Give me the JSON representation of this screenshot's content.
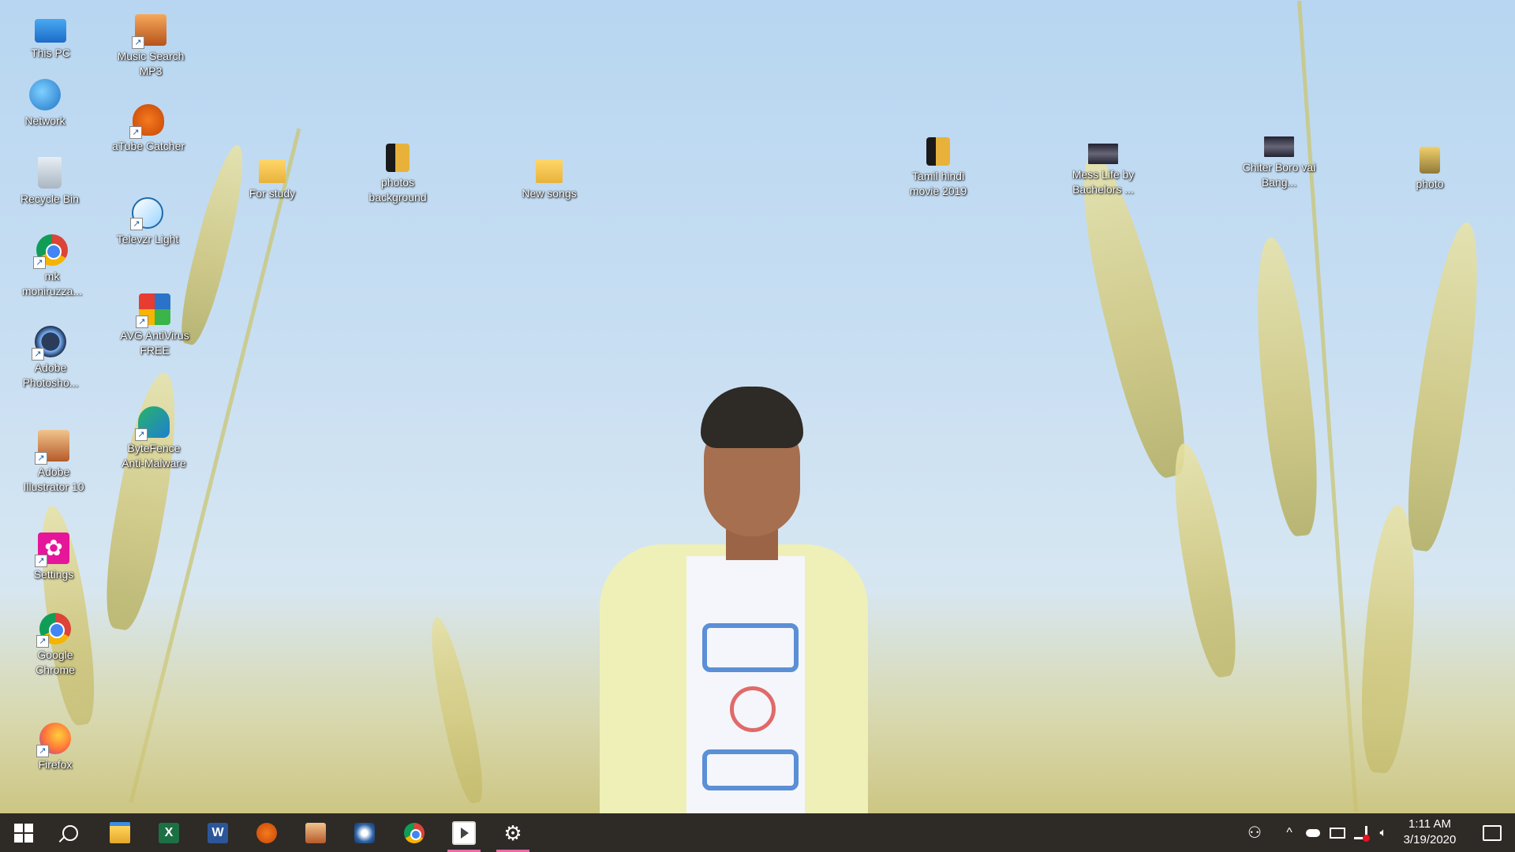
{
  "desktop": {
    "icons": [
      {
        "label": "This PC",
        "icon": "computer-icon"
      },
      {
        "label": "Network",
        "icon": "network-icon"
      },
      {
        "label": "Recycle Bin",
        "icon": "recycle-bin-icon"
      },
      {
        "label": "mk moniruzza...",
        "icon": "chrome-profile-icon"
      },
      {
        "label": "Adobe Photosho...",
        "icon": "photoshop-icon"
      },
      {
        "label": "Adobe Illustrator 10",
        "icon": "illustrator-icon"
      },
      {
        "label": "Settings",
        "icon": "settings-gear-icon"
      },
      {
        "label": "Google Chrome",
        "icon": "chrome-icon"
      },
      {
        "label": "Firefox",
        "icon": "firefox-icon"
      },
      {
        "label": "Music Search MP3",
        "icon": "music-search-icon"
      },
      {
        "label": "aTube Catcher",
        "icon": "atube-catcher-icon"
      },
      {
        "label": "Televzr Light",
        "icon": "televzr-icon"
      },
      {
        "label": "AVG AntiVirus FREE",
        "icon": "avg-antivirus-icon"
      },
      {
        "label": "ByteFence Anti-Malware",
        "icon": "bytefence-icon"
      },
      {
        "label": "For study",
        "icon": "folder-icon"
      },
      {
        "label": "photos background",
        "icon": "folder-icon"
      },
      {
        "label": "New songs",
        "icon": "folder-icon"
      },
      {
        "label": "Tamil hindi movie 2019",
        "icon": "folder-icon"
      },
      {
        "label": "Mess Life by Bachelors ...",
        "icon": "video-file-icon"
      },
      {
        "label": "Chiter Boro vai Bang...",
        "icon": "video-file-icon"
      },
      {
        "label": "photo",
        "icon": "folder-icon"
      }
    ]
  },
  "taskbar": {
    "start": "windows-start-icon",
    "search": "search-icon",
    "pinned": [
      {
        "name": "File Explorer",
        "icon": "file-explorer-icon",
        "text": ""
      },
      {
        "name": "Excel",
        "icon": "excel-icon",
        "text": "X"
      },
      {
        "name": "Word",
        "icon": "word-icon",
        "text": "W"
      },
      {
        "name": "aTube Catcher",
        "icon": "atube-catcher-icon",
        "text": ""
      },
      {
        "name": "Adobe Illustrator",
        "icon": "illustrator-icon",
        "text": ""
      },
      {
        "name": "Adobe Photoshop",
        "icon": "photoshop-icon",
        "text": ""
      },
      {
        "name": "Google Chrome",
        "icon": "chrome-icon",
        "text": ""
      },
      {
        "name": "Media Player",
        "icon": "media-player-icon",
        "text": ""
      },
      {
        "name": "Settings",
        "icon": "gear-icon",
        "text": "⚙"
      }
    ],
    "tray": {
      "people_glyph": "⚇",
      "chevron_glyph": "^",
      "volume_glyph": "🔈︎",
      "time": "1:11 AM",
      "date": "3/19/2020"
    },
    "accent_color": "#e86aa6"
  }
}
